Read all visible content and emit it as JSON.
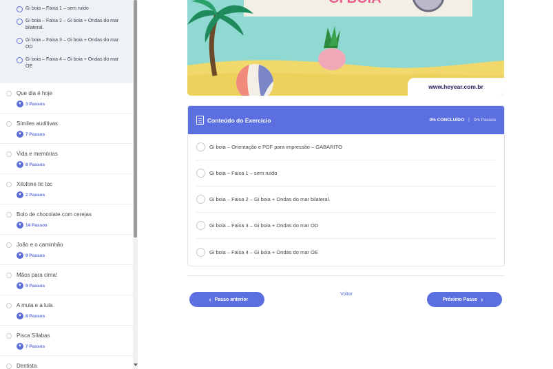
{
  "sidebar": {
    "sub_steps": [
      {
        "label": "Gi boia – Faixa 1 – sem ruído"
      },
      {
        "label": "Gi boia – Faixa 2 – Gi boia + Ondas do mar bilateral."
      },
      {
        "label": "Gi boia – Faixa 3 – Gi boia + Ondas do mar OD"
      },
      {
        "label": "Gi boia – Faixa 4 – Gi boia + Ondas do mar OE"
      }
    ],
    "lessons": [
      {
        "title": "Que dia é hoje",
        "steps": "3 Passos"
      },
      {
        "title": "Símiles auditivas",
        "steps": "7 Passos"
      },
      {
        "title": "Vida e memórias",
        "steps": "8 Passos"
      },
      {
        "title": "Xilofone tic toc",
        "steps": "2 Passos"
      },
      {
        "title": "Bolo de chocolate com cerejas",
        "steps": "14 Passos"
      },
      {
        "title": "João e o caminhão",
        "steps": "9 Passos"
      },
      {
        "title": "Mãos para cima!",
        "steps": "9 Passos"
      },
      {
        "title": "A mula e a lula",
        "steps": "8 Passos"
      },
      {
        "title": "Pisca Sílabas",
        "steps": "7 Passos"
      },
      {
        "title": "Dentista",
        "steps": ""
      }
    ]
  },
  "banner": {
    "title": "GI BOIA",
    "url": "www.heyear.com.br"
  },
  "content": {
    "title": "Conteúdo do Exercício",
    "progress": "0% CONCLUÍDO",
    "separator": "|",
    "steps_count": "0/5 Passos",
    "items": [
      {
        "label": "Gi boia – Orientação e PDF para impressão – GABARITO"
      },
      {
        "label": "Gi boia – Faixa 1 – sem ruído"
      },
      {
        "label": "Gi boia – Faixa 2 – Gi boia + Ondas do mar bilateral."
      },
      {
        "label": "Gi boia – Faixa 3 – Gi boia + Ondas do mar OD"
      },
      {
        "label": "Gi boia – Faixa 4 – Gi boia + Ondas do mar OE"
      }
    ]
  },
  "nav": {
    "prev_label": "Passo anterior",
    "back_label": "Voltar",
    "next_label": "Próximo Passo",
    "prev_arrow": "‹",
    "next_arrow": "›"
  },
  "colors": {
    "accent": "#5b6fe0",
    "banner_sky": "#8fd9d2",
    "sand": "#f0d96a"
  }
}
